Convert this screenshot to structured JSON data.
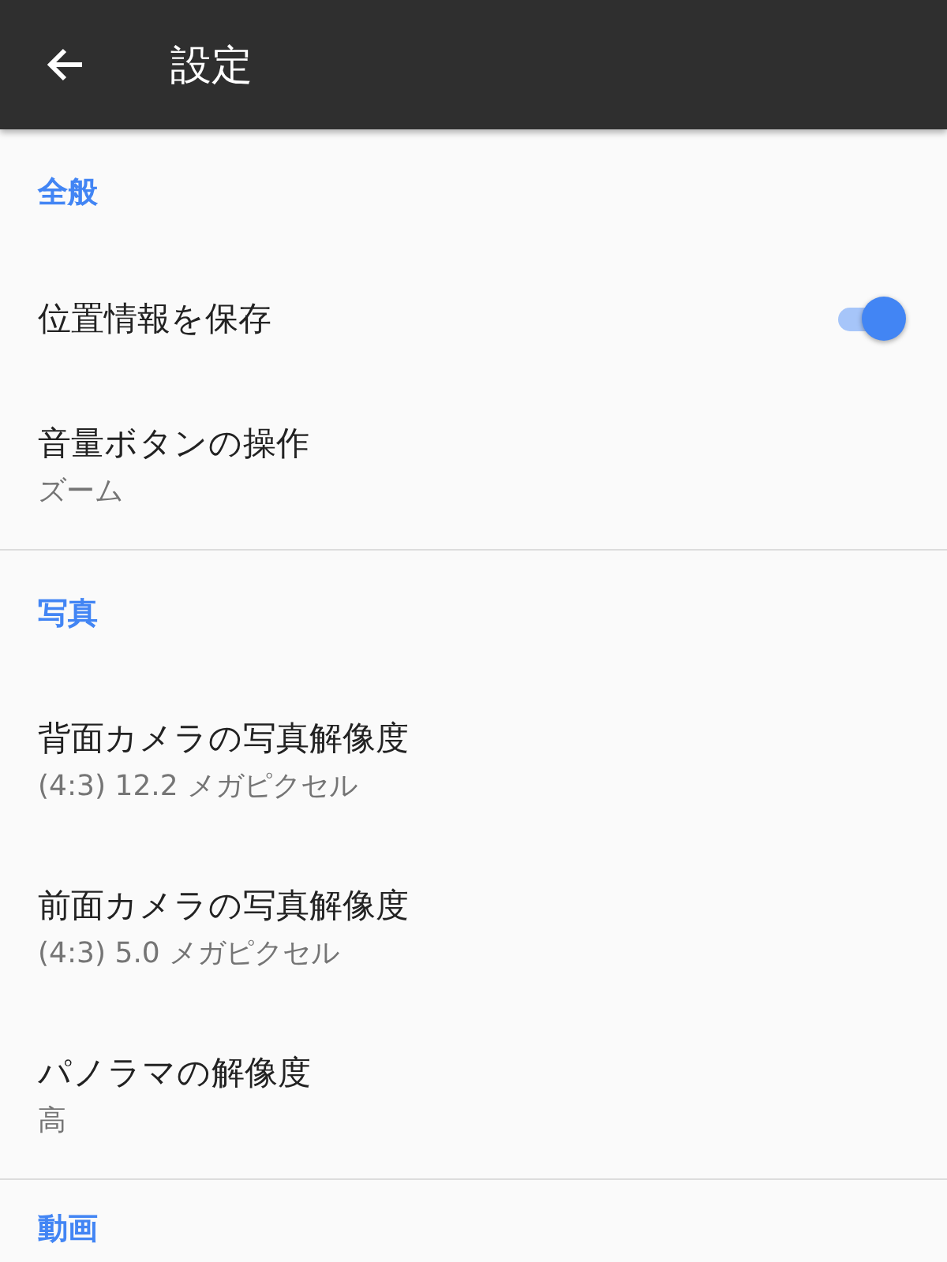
{
  "app_bar": {
    "title": "設定"
  },
  "sections": [
    {
      "header": "全般",
      "items": [
        {
          "kind": "toggle",
          "title": "位置情報を保存",
          "on": true
        },
        {
          "kind": "plain",
          "title": "音量ボタンの操作",
          "summary": "ズーム"
        }
      ]
    },
    {
      "header": "写真",
      "items": [
        {
          "kind": "plain",
          "title": "背面カメラの写真解像度",
          "summary": "(4:3) 12.2 メガピクセル"
        },
        {
          "kind": "plain",
          "title": "前面カメラの写真解像度",
          "summary": "(4:3) 5.0 メガピクセル"
        },
        {
          "kind": "plain",
          "title": "パノラマの解像度",
          "summary": "高"
        }
      ]
    },
    {
      "header": "動画"
    }
  ]
}
